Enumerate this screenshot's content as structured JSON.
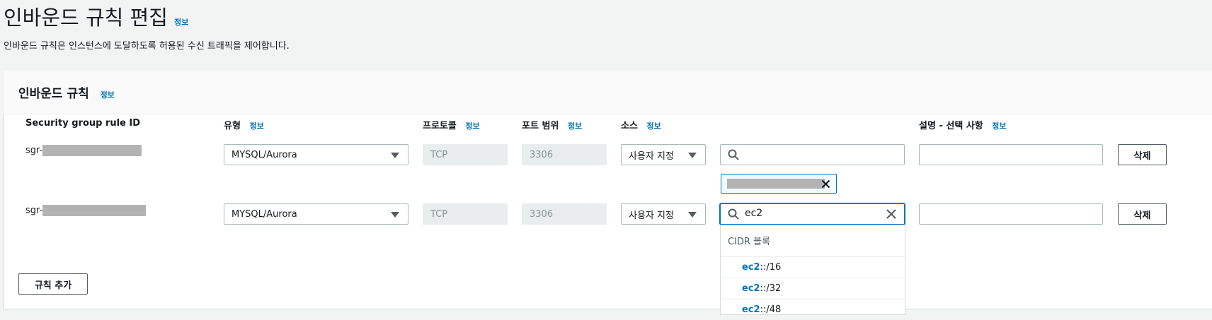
{
  "page": {
    "title": "인바운드 규칙 편집",
    "info": "정보",
    "description": "인바운드 규칙은 인스턴스에 도달하도록 허용된 수신 트래픽을 제어합니다."
  },
  "panel": {
    "title": "인바운드 규칙",
    "info": "정보"
  },
  "columns": {
    "rule_id": "Security group rule ID",
    "type": "유형",
    "protocol": "프로토콜",
    "port_range": "포트 범위",
    "source": "소스",
    "description": "설명 - 선택 사항",
    "info": "정보"
  },
  "rules": [
    {
      "id_prefix": "sgr-",
      "type": "MYSQL/Aurora",
      "protocol": "TCP",
      "port": "3306",
      "source_mode": "사용자 지정",
      "search_value": "",
      "description": "",
      "delete_label": "삭제"
    },
    {
      "id_prefix": "sgr-",
      "type": "MYSQL/Aurora",
      "protocol": "TCP",
      "port": "3306",
      "source_mode": "사용자 지정",
      "search_value": "ec2",
      "description": "",
      "delete_label": "삭제"
    }
  ],
  "add_rule_label": "규칙 추가",
  "dropdown": {
    "group_label": "CIDR 블록",
    "options": [
      {
        "match": "ec2",
        "rest": "::/16"
      },
      {
        "match": "ec2",
        "rest": "::/32"
      },
      {
        "match": "ec2",
        "rest": "::/48"
      }
    ]
  },
  "colors": {
    "link": "#0073bb",
    "background": "#f2f3f3",
    "readonly": "#eaeded",
    "masked": "#b3b3b3"
  },
  "icons": {
    "search": "search-icon",
    "clear": "close-icon",
    "caret": "caret-down-icon"
  }
}
